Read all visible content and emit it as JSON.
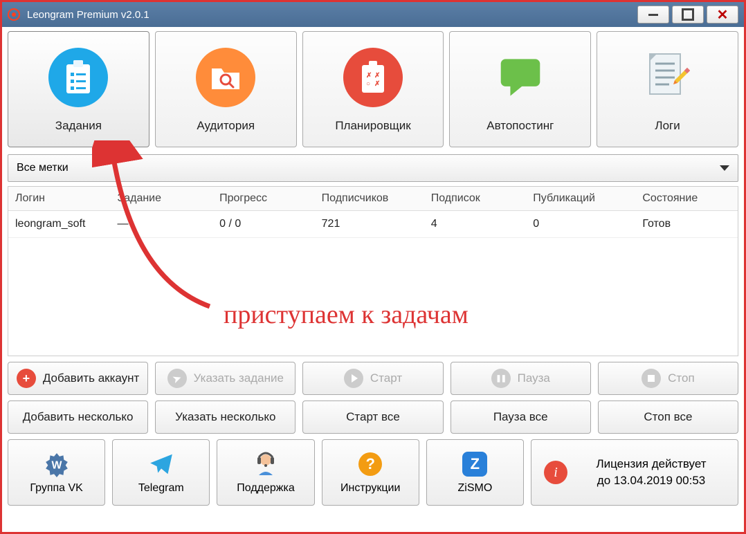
{
  "window": {
    "title": "Leongram Premium v2.0.1"
  },
  "toolbar": {
    "tasks": "Задания",
    "audience": "Аудитория",
    "scheduler": "Планировщик",
    "autoposting": "Автопостинг",
    "logs": "Логи"
  },
  "filter": {
    "all_tags": "Все метки"
  },
  "table": {
    "headers": {
      "login": "Логин",
      "task": "Задание",
      "progress": "Прогресс",
      "followers": "Подписчиков",
      "following": "Подписок",
      "posts": "Публикаций",
      "state": "Состояние"
    },
    "rows": [
      {
        "login": "leongram_soft",
        "task": "—",
        "progress": "0 / 0",
        "followers": "721",
        "following": "4",
        "posts": "0",
        "state": "Готов"
      }
    ]
  },
  "annotation": "приступаем к задачам",
  "actions": {
    "add_account": "Добавить аккаунт",
    "set_task": "Указать задание",
    "start": "Старт",
    "pause": "Пауза",
    "stop": "Стоп",
    "add_several": "Добавить несколько",
    "set_several": "Указать несколько",
    "start_all": "Старт все",
    "pause_all": "Пауза все",
    "stop_all": "Стоп все"
  },
  "bottom": {
    "vk": "Группа VK",
    "telegram": "Telegram",
    "support": "Поддержка",
    "instructions": "Инструкции",
    "zismo": "ZiSMO"
  },
  "license": {
    "line1": "Лицензия действует",
    "line2": "до 13.04.2019 00:53"
  }
}
